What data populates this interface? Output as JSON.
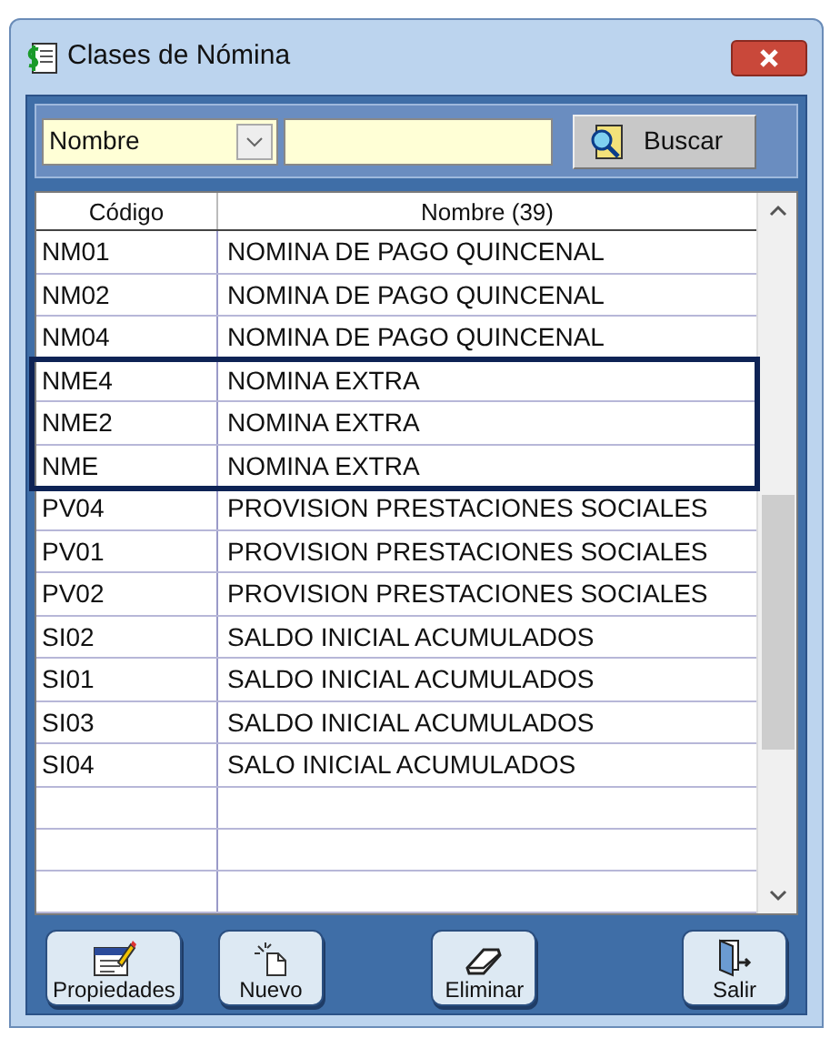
{
  "window": {
    "title": "Clases de Nómina"
  },
  "search": {
    "field_selector": "Nombre",
    "button": "Buscar"
  },
  "table": {
    "columns": [
      "Código",
      "Nombre (39)"
    ],
    "rows": [
      {
        "code": "NM01",
        "name": "NOMINA DE PAGO QUINCENAL",
        "highlighted": false
      },
      {
        "code": "NM02",
        "name": "NOMINA DE PAGO QUINCENAL",
        "highlighted": false
      },
      {
        "code": "NM04",
        "name": "NOMINA DE PAGO QUINCENAL",
        "highlighted": false
      },
      {
        "code": "NME4",
        "name": "NOMINA EXTRA",
        "highlighted": true
      },
      {
        "code": "NME2",
        "name": "NOMINA EXTRA",
        "highlighted": true
      },
      {
        "code": "NME",
        "name": "NOMINA EXTRA",
        "highlighted": true
      },
      {
        "code": "PV04",
        "name": "PROVISION PRESTACIONES SOCIALES",
        "highlighted": false
      },
      {
        "code": "PV01",
        "name": "PROVISION PRESTACIONES SOCIALES",
        "highlighted": false
      },
      {
        "code": "PV02",
        "name": "PROVISION PRESTACIONES SOCIALES",
        "highlighted": false
      },
      {
        "code": "SI02",
        "name": "SALDO INICIAL ACUMULADOS",
        "highlighted": false
      },
      {
        "code": "SI01",
        "name": "SALDO INICIAL ACUMULADOS",
        "highlighted": false
      },
      {
        "code": "SI03",
        "name": "SALDO INICIAL ACUMULADOS",
        "highlighted": false
      },
      {
        "code": "SI04",
        "name": "SALO INICIAL ACUMULADOS",
        "highlighted": false
      }
    ]
  },
  "buttons": [
    {
      "label": "Propiedades",
      "kind": "properties"
    },
    {
      "label": "Nuevo",
      "kind": "new"
    },
    {
      "label": "Eliminar",
      "kind": "delete"
    },
    {
      "label": "Salir",
      "kind": "exit"
    }
  ]
}
